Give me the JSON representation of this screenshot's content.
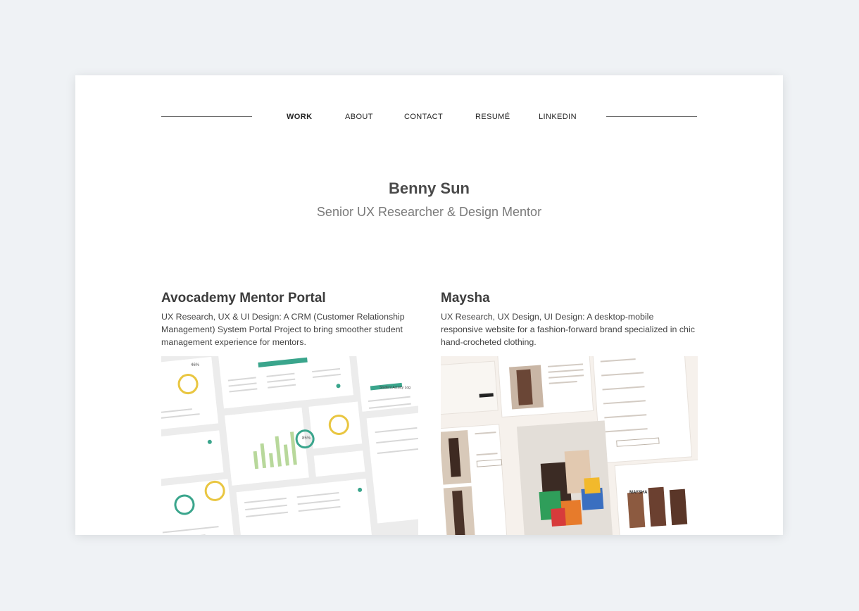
{
  "nav": {
    "items": [
      {
        "label": "WORK",
        "active": true
      },
      {
        "label": "ABOUT",
        "active": false
      },
      {
        "label": "CONTACT",
        "active": false
      },
      {
        "label": "RESUMÉ",
        "active": false
      },
      {
        "label": "LINKEDIN",
        "active": false
      }
    ]
  },
  "hero": {
    "name": "Benny Sun",
    "role": "Senior UX Researcher & Design Mentor"
  },
  "projects": [
    {
      "title": "Avocademy Mentor Portal",
      "description": "UX Research, UX & UI Design: A CRM (Customer Relationship Management) System Portal Project to bring smoother student management experience for mentors.",
      "thumbnail_text": {
        "stat_a": "85%",
        "stat_b": "46%",
        "panel_title": "Student Activity Log"
      }
    },
    {
      "title": "Maysha",
      "description": "UX Research, UX Design, UI Design: A desktop-mobile responsive website for a fashion-forward brand specialized in chic hand-crocheted clothing.",
      "thumbnail_text": {
        "brand": "MAYSHA"
      }
    }
  ],
  "colors": {
    "background": "#eff2f5",
    "page": "#ffffff",
    "accent_teal": "#3aa58c",
    "accent_yellow": "#e9c641",
    "accent_green": "#9bc07a"
  }
}
